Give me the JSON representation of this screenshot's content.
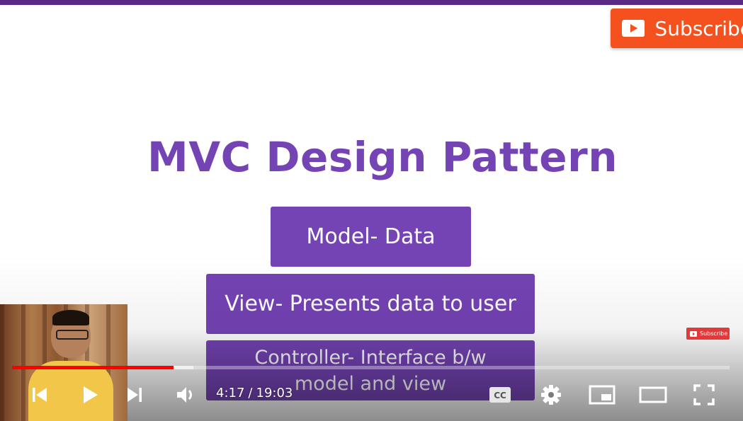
{
  "slide": {
    "title": "MVC Design Pattern",
    "model_box": "Model- Data",
    "view_box": "View- Presents data to user",
    "controller_box_line1": "Controller- Interface b/w",
    "controller_box_line2": "model and view"
  },
  "branding": {
    "subscribe_label": "Subscribe",
    "subscribe_small_label": "Subscribe",
    "subscribe_color": "#f4511e",
    "slide_color": "#7443b4"
  },
  "player": {
    "current_time": "4:17",
    "separator": "/",
    "duration": "19:03",
    "played_fraction": 0.225,
    "buffered_fraction": 0.253,
    "progress_color": "#ff0000"
  },
  "icons": {
    "previous": "skip-previous-icon",
    "play": "play-icon",
    "next": "skip-next-icon",
    "volume": "volume-icon",
    "captions": "closed-captions-icon",
    "settings": "gear-icon",
    "miniplayer": "miniplayer-icon",
    "theater": "theater-mode-icon",
    "fullscreen": "fullscreen-icon"
  }
}
